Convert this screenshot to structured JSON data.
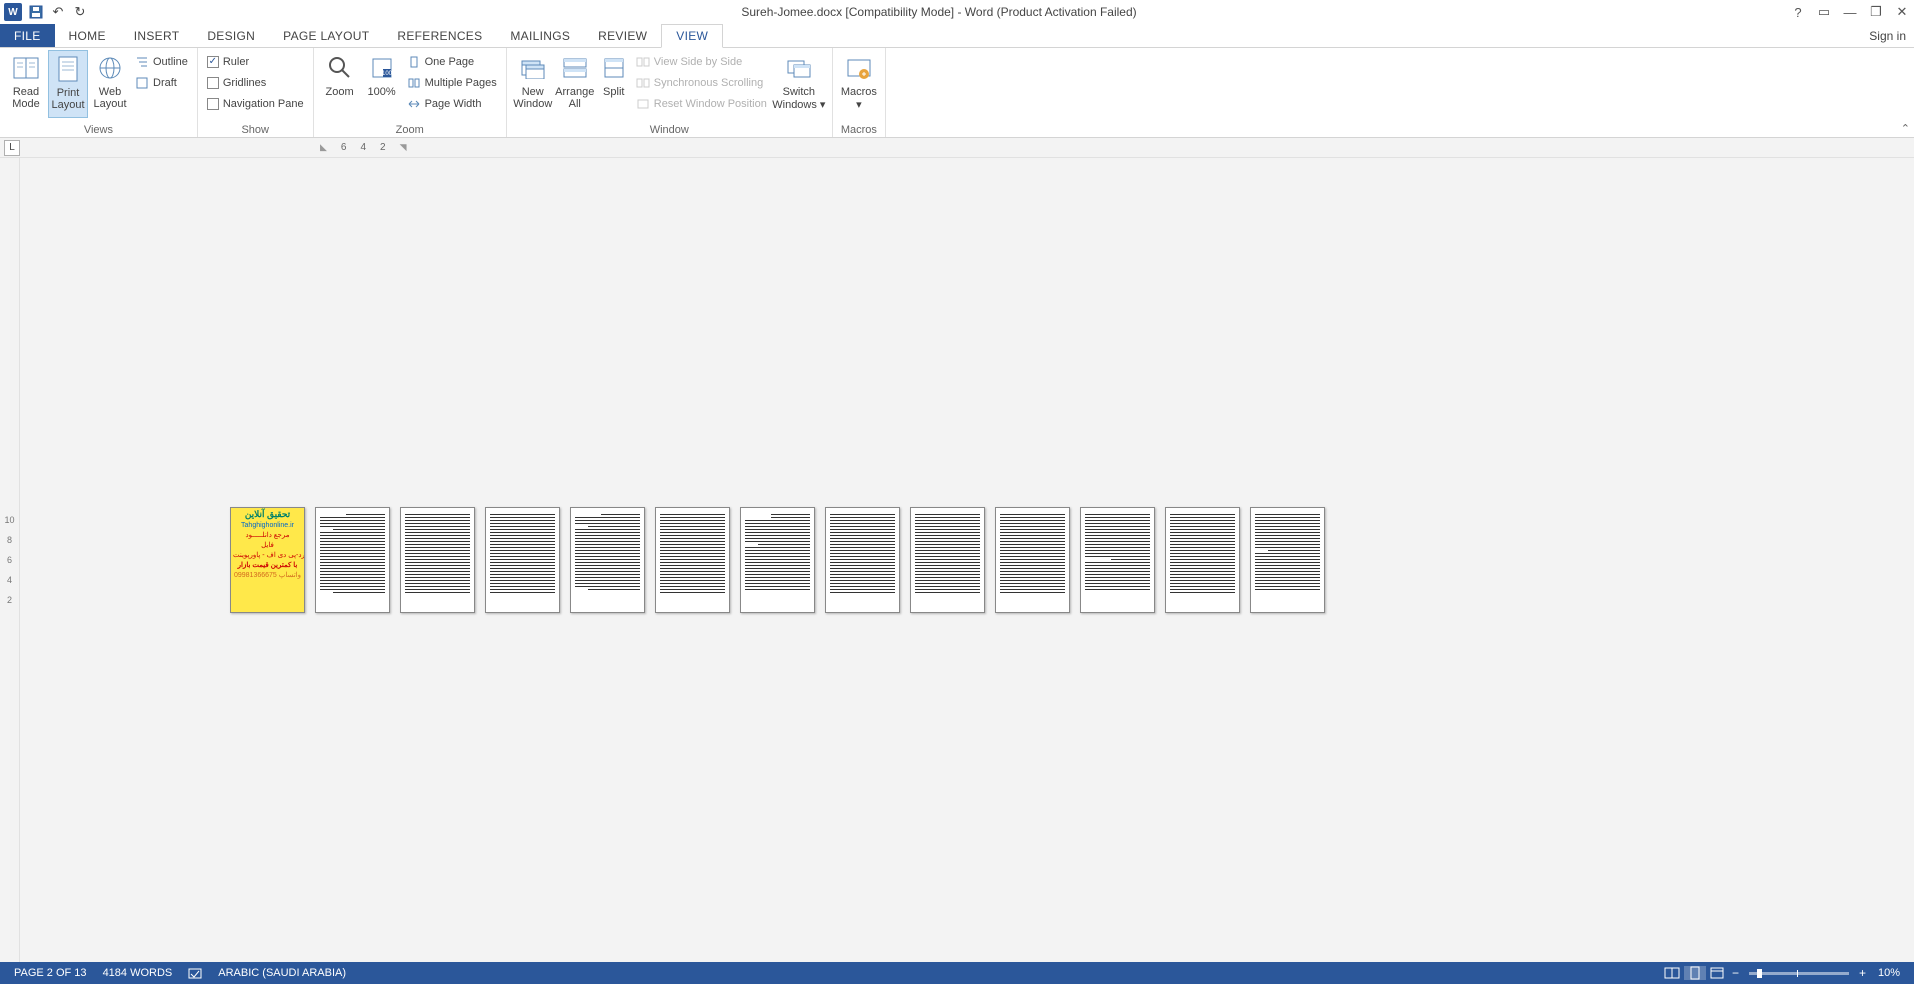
{
  "title": "Sureh-Jomee.docx [Compatibility Mode] - Word (Product Activation Failed)",
  "qat": {
    "save": "💾",
    "undo": "↶",
    "redo": "↻"
  },
  "win": {
    "help": "?",
    "opts": "▭",
    "min": "—",
    "restore": "❐",
    "close": "✕"
  },
  "tabs": {
    "file": "FILE",
    "home": "HOME",
    "insert": "INSERT",
    "design": "DESIGN",
    "page_layout": "PAGE LAYOUT",
    "references": "REFERENCES",
    "mailings": "MAILINGS",
    "review": "REVIEW",
    "view": "VIEW",
    "sign_in": "Sign in"
  },
  "ribbon": {
    "views": {
      "label": "Views",
      "read_mode": "Read Mode",
      "print_layout": "Print Layout",
      "web_layout": "Web Layout",
      "outline": "Outline",
      "draft": "Draft"
    },
    "show": {
      "label": "Show",
      "ruler": "Ruler",
      "gridlines": "Gridlines",
      "nav_pane": "Navigation Pane",
      "ruler_checked": true,
      "gridlines_checked": false,
      "nav_checked": false
    },
    "zoom": {
      "label": "Zoom",
      "zoom": "Zoom",
      "p100": "100%",
      "one_page": "One Page",
      "multi": "Multiple Pages",
      "page_width": "Page Width"
    },
    "window": {
      "label": "Window",
      "new_window": "New Window",
      "arrange_all": "Arrange All",
      "split": "Split",
      "side_by_side": "View Side by Side",
      "sync_scroll": "Synchronous Scrolling",
      "reset_pos": "Reset Window Position",
      "switch": "Switch Windows"
    },
    "macros": {
      "label": "Macros",
      "macros": "Macros"
    }
  },
  "ruler_marks": [
    "6",
    "4",
    "2"
  ],
  "vruler": [
    "10",
    "8",
    "6",
    "4",
    "2"
  ],
  "cover": {
    "l1": "تحقیق آنلاین",
    "l2": "Tahghighonline.ir",
    "l3": "مرجع دانلـــــود",
    "l4": "فایل",
    "l5": "ورد-پی دی اف - پاورپوینت",
    "l6": "با کمترین قیمت بازار",
    "l7": "09981366675 واتساپ"
  },
  "status": {
    "page": "PAGE 2 OF 13",
    "words": "4184 WORDS",
    "lang": "ARABIC (SAUDI ARABIA)",
    "zoom_pct": "10%"
  },
  "tab_sel": "L"
}
